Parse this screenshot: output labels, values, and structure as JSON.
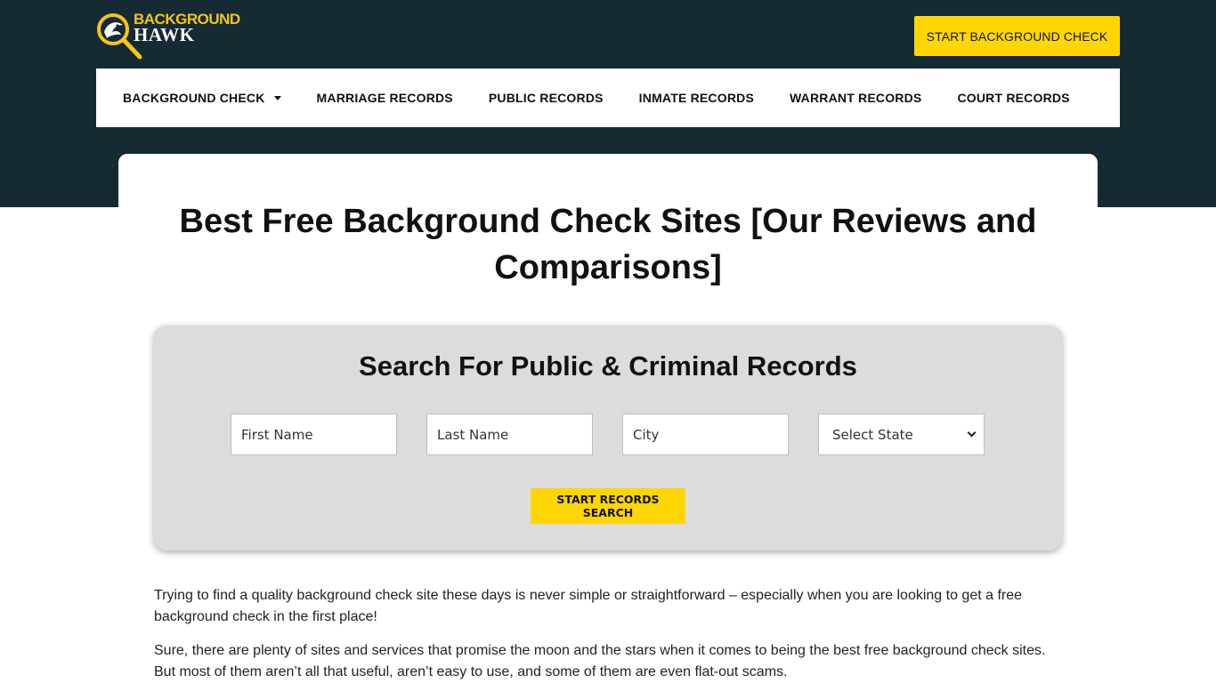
{
  "brand": {
    "name_line1": "BACKGROUND",
    "name_line2": "HAWK",
    "colors": {
      "dark": "#152a33",
      "accent": "#ffd600"
    }
  },
  "header": {
    "cta_label": "START BACKGROUND CHECK"
  },
  "nav": {
    "items": [
      {
        "label": "BACKGROUND CHECK",
        "has_dropdown": true
      },
      {
        "label": "MARRIAGE RECORDS"
      },
      {
        "label": "PUBLIC RECORDS"
      },
      {
        "label": "INMATE RECORDS"
      },
      {
        "label": "WARRANT RECORDS"
      },
      {
        "label": "COURT RECORDS"
      }
    ]
  },
  "main": {
    "title": "Best Free Background Check Sites [Our Reviews and Comparisons]",
    "search": {
      "heading": "Search For Public & Criminal Records",
      "first_name_placeholder": "First Name",
      "last_name_placeholder": "Last Name",
      "city_placeholder": "City",
      "state_selected": "Select State",
      "button_label": "START RECORDS SEARCH"
    },
    "paragraphs": [
      "Trying to find a quality background check site these days is never simple or straightforward – especially when you are looking to get a free background check in the first place!",
      "Sure, there are plenty of sites and services that promise the moon and the stars when it comes to being the best free background check sites. But most of them aren’t all that useful, aren’t easy to use, and some of them are even flat-out scams."
    ]
  }
}
